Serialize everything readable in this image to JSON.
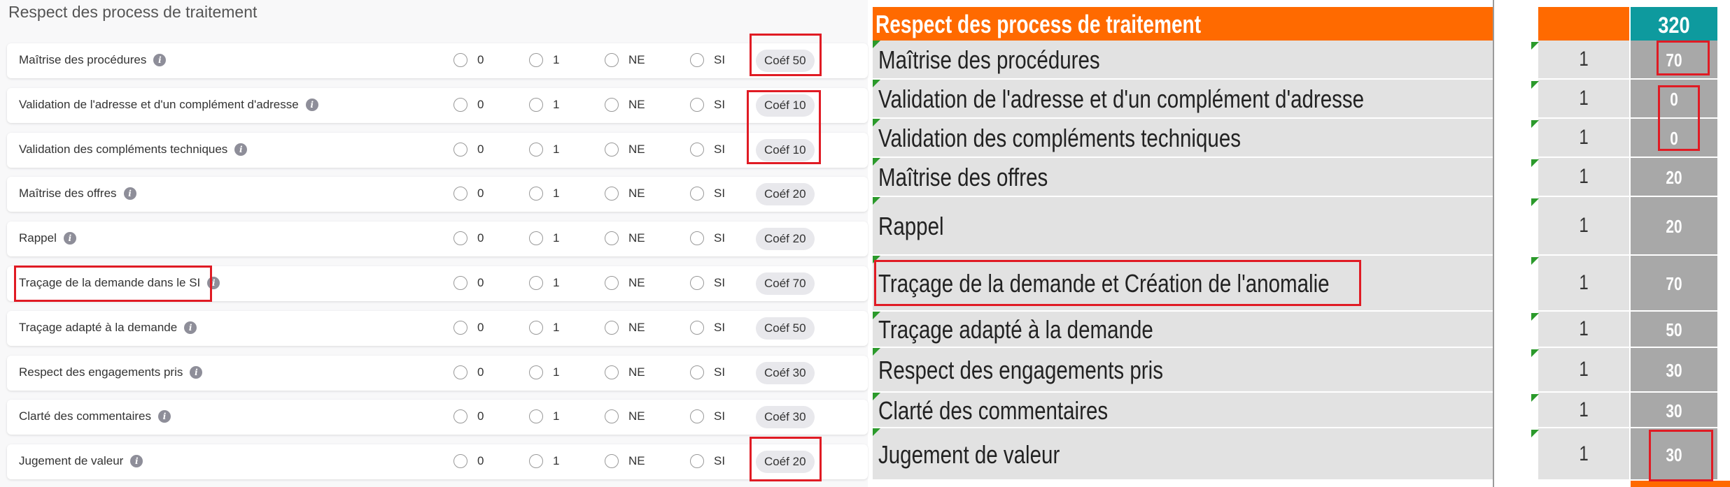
{
  "form": {
    "title": "Respect des process de traitement",
    "options": [
      "0",
      "1",
      "NE",
      "SI"
    ],
    "rows": [
      {
        "label": "Maîtrise des procédures",
        "coef": "Coéf 50"
      },
      {
        "label": "Validation de l'adresse et d'un complément d'adresse",
        "coef": "Coéf 10"
      },
      {
        "label": "Validation des compléments techniques",
        "coef": "Coéf 10"
      },
      {
        "label": "Maîtrise des offres",
        "coef": "Coéf 20"
      },
      {
        "label": "Rappel",
        "coef": "Coéf 20"
      },
      {
        "label": "Traçage de la demande dans le SI",
        "coef": "Coéf 70"
      },
      {
        "label": "Traçage adapté à la demande",
        "coef": "Coéf 50"
      },
      {
        "label": "Respect des engagements pris",
        "coef": "Coéf 30"
      },
      {
        "label": "Clarté des commentaires",
        "coef": "Coéf 30"
      },
      {
        "label": "Jugement de valeur",
        "coef": "Coéf 20"
      }
    ]
  },
  "sheet": {
    "header_title": "Respect des process de traitement",
    "header_total": "320",
    "rows": [
      {
        "label": "Maîtrise des procédures",
        "score": "1",
        "coef": "70"
      },
      {
        "label": "Validation de l'adresse et d'un complément d'adresse",
        "score": "1",
        "coef": "0"
      },
      {
        "label": "Validation des compléments techniques",
        "score": "1",
        "coef": "0"
      },
      {
        "label": "Maîtrise des offres",
        "score": "1",
        "coef": "20"
      },
      {
        "label": "Rappel",
        "score": "1",
        "coef": "20"
      },
      {
        "label": "Traçage de la demande et Création de l'anomalie",
        "score": "1",
        "coef": "70"
      },
      {
        "label": "Traçage adapté à la demande",
        "score": "1",
        "coef": "50"
      },
      {
        "label": "Respect des engagements pris",
        "score": "1",
        "coef": "30"
      },
      {
        "label": "Clarté des commentaires",
        "score": "1",
        "coef": "30"
      },
      {
        "label": "Jugement de valeur",
        "score": "1",
        "coef": "30"
      }
    ]
  },
  "colors": {
    "header_orange": "#ff6a00",
    "header_teal": "#0e9a9e",
    "highlight_red": "#e01b24",
    "corner_green": "#2b9a2b"
  },
  "icons": {
    "info": "info-icon"
  }
}
